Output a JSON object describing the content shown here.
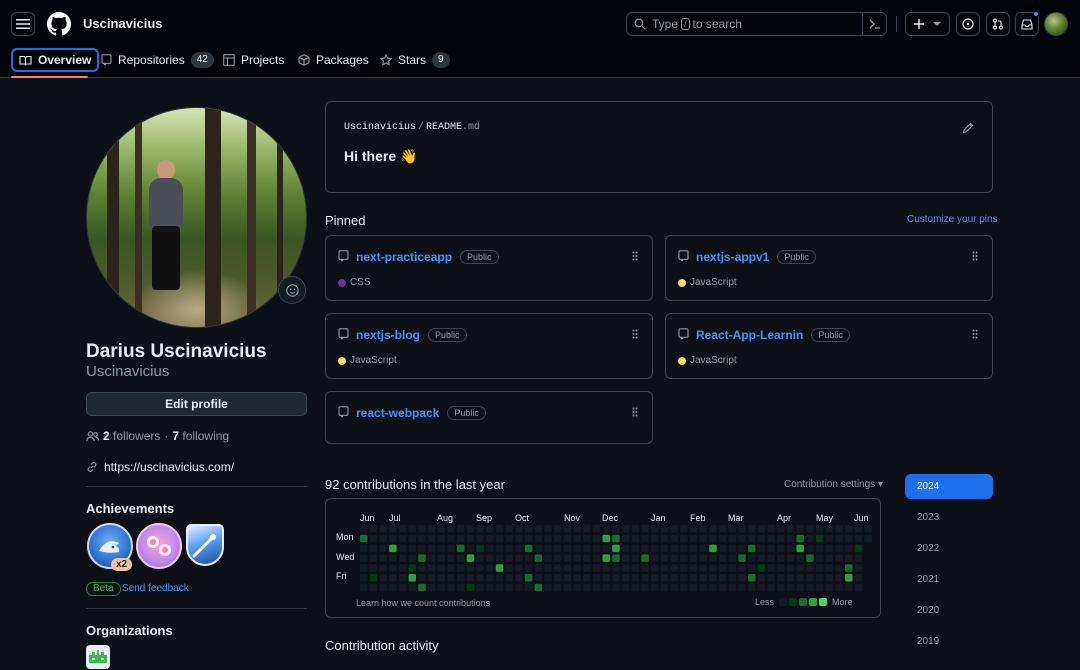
{
  "header": {
    "username": "Uscinavicius",
    "search": {
      "prefix": "Type",
      "key": "/",
      "suffix": "to search"
    }
  },
  "tabs": [
    {
      "label": "Overview",
      "icon": "book-icon",
      "selected": true
    },
    {
      "label": "Repositories",
      "icon": "repo-icon",
      "count": "42"
    },
    {
      "label": "Projects",
      "icon": "table-icon"
    },
    {
      "label": "Packages",
      "icon": "package-icon"
    },
    {
      "label": "Stars",
      "icon": "star-icon",
      "count": "9"
    }
  ],
  "profile": {
    "full_name": "Darius Uscinavicius",
    "login": "Uscinavicius",
    "edit_label": "Edit profile",
    "followers": "2",
    "followers_label": "followers",
    "separator": "·",
    "following": "7",
    "following_label": "following",
    "website": "https://uscinavicius.com/"
  },
  "achievements": {
    "heading": "Achievements",
    "multiplier": "x2",
    "beta": "Beta",
    "feedback": "Send feedback"
  },
  "organizations": {
    "heading": "Organizations"
  },
  "readme": {
    "owner": "Uscinavicius",
    "sep": "/",
    "file": "README",
    "ext": ".md",
    "greeting": "Hi there 👋"
  },
  "pinned": {
    "heading": "Pinned",
    "customize": "Customize your pins",
    "repos": [
      {
        "name": "next-practiceapp",
        "visibility": "Public",
        "language": "CSS",
        "color": "#663399"
      },
      {
        "name": "nextjs-appv1",
        "visibility": "Public",
        "language": "JavaScript",
        "color": "#f1e05a"
      },
      {
        "name": "nextjs-blog",
        "visibility": "Public",
        "language": "JavaScript",
        "color": "#f1e05a"
      },
      {
        "name": "React-App-Learnin",
        "visibility": "Public",
        "language": "JavaScript",
        "color": "#f1e05a"
      },
      {
        "name": "react-webpack",
        "visibility": "Public",
        "language": ""
      }
    ]
  },
  "contributions": {
    "heading": "92 contributions in the last year",
    "settings": "Contribution settings ▾",
    "months": [
      "Jun",
      "Jul",
      "Aug",
      "Sep",
      "Oct",
      "Nov",
      "Dec",
      "Jan",
      "Feb",
      "Mar",
      "Apr",
      "May",
      "Jun"
    ],
    "days": [
      "Mon",
      "Wed",
      "Fri"
    ],
    "learn": "Learn how we count contributions",
    "less": "Less",
    "more": "More",
    "levels": [
      "#151b23",
      "#033a16",
      "#196c2e",
      "#2ea043",
      "#56d364"
    ],
    "active_cells": [
      [
        0,
        1,
        2
      ],
      [
        1,
        5,
        1
      ],
      [
        3,
        2,
        3
      ],
      [
        5,
        4,
        1
      ],
      [
        5,
        5,
        3
      ],
      [
        6,
        3,
        2
      ],
      [
        6,
        6,
        2
      ],
      [
        10,
        2,
        2
      ],
      [
        11,
        3,
        3
      ],
      [
        11,
        6,
        1
      ],
      [
        12,
        2,
        1
      ],
      [
        14,
        4,
        3
      ],
      [
        17,
        2,
        2
      ],
      [
        17,
        5,
        2
      ],
      [
        18,
        3,
        2
      ],
      [
        18,
        6,
        2
      ],
      [
        25,
        1,
        3
      ],
      [
        25,
        3,
        3
      ],
      [
        25,
        7,
        2
      ],
      [
        26,
        1,
        2
      ],
      [
        26,
        2,
        3
      ],
      [
        26,
        3,
        2
      ],
      [
        29,
        3,
        2
      ],
      [
        36,
        2,
        3
      ],
      [
        39,
        3,
        2
      ],
      [
        40,
        2,
        2
      ],
      [
        40,
        5,
        2
      ],
      [
        41,
        4,
        1
      ],
      [
        45,
        1,
        2
      ],
      [
        45,
        2,
        3
      ],
      [
        46,
        3,
        2
      ],
      [
        47,
        1,
        1
      ],
      [
        50,
        4,
        2
      ],
      [
        50,
        5,
        3
      ],
      [
        51,
        2,
        1
      ]
    ]
  },
  "years": [
    "2024",
    "2023",
    "2022",
    "2021",
    "2020",
    "2019"
  ],
  "activity": {
    "heading": "Contribution activity"
  }
}
